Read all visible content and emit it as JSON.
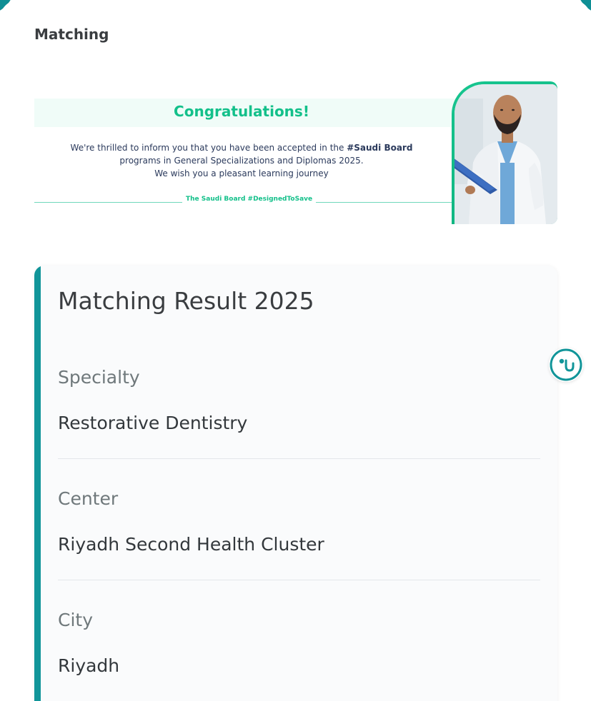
{
  "page": {
    "heading": "Matching"
  },
  "banner": {
    "title": "Congratulations!",
    "line1_prefix": "We're thrilled to inform you that you have been accepted in the ",
    "line1_bold": "#Saudi Board",
    "line2": "programs in General Specializations and Diplomas 2025.",
    "line3": "We wish you a pleasant learning journey",
    "footer": "The Saudi Board #DesignedToSave",
    "image_icon": "doctor-with-clipboard-photo"
  },
  "result": {
    "title": "Matching Result 2025",
    "fields": [
      {
        "label": "Specialty",
        "value": "Restorative Dentistry"
      },
      {
        "label": "Center",
        "value": "Riyadh Second Health Cluster"
      },
      {
        "label": "City",
        "value": "Riyadh"
      }
    ]
  },
  "help_button": {
    "icon": "stethoscope-icon"
  },
  "colors": {
    "accent_teal": "#119599",
    "brand_green": "#13c08a",
    "text_dark": "#3a3d40",
    "text_muted": "#6f787b"
  }
}
